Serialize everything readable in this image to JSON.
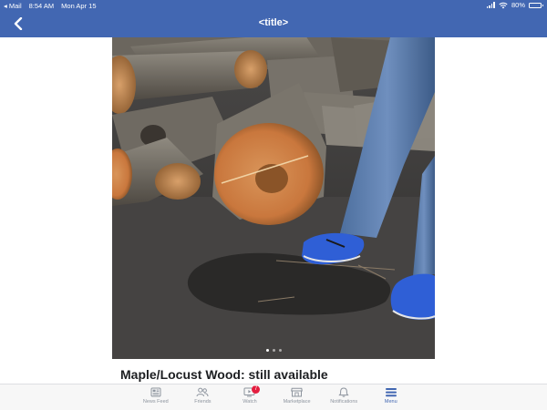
{
  "status_bar": {
    "back_app": "Mail",
    "time": "8:54 AM",
    "date": "Mon Apr 15",
    "battery": "80%",
    "battery_level": 0.8
  },
  "nav": {
    "title": "<title>",
    "back_icon": "chevron-left-icon"
  },
  "post": {
    "title": "Maple/Locust Wood: still available",
    "photo_count": 3,
    "current_photo": 1
  },
  "tabbar": {
    "tabs": [
      {
        "label": "News Feed",
        "icon": "news-feed-icon",
        "active": false
      },
      {
        "label": "Friends",
        "icon": "friends-icon",
        "active": false
      },
      {
        "label": "Watch",
        "icon": "watch-icon",
        "active": false,
        "badge": "7"
      },
      {
        "label": "Marketplace",
        "icon": "marketplace-icon",
        "active": false
      },
      {
        "label": "Notifications",
        "icon": "bell-icon",
        "active": false
      },
      {
        "label": "Menu",
        "icon": "menu-icon",
        "active": true
      }
    ]
  },
  "colors": {
    "brand": "#4267b2",
    "badge": "#e41e3f",
    "tab_inactive": "#8d949e"
  }
}
